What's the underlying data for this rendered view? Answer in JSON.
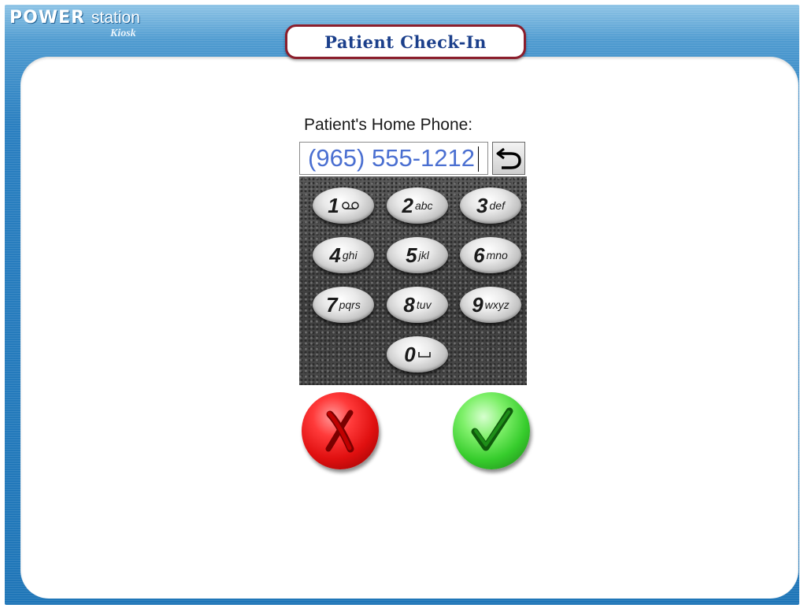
{
  "app": {
    "logo_power": "POWER",
    "logo_station": "station",
    "logo_kiosk": "Kiosk"
  },
  "header": {
    "title": "Patient Check-In"
  },
  "form": {
    "phone_label": "Patient's Home Phone:",
    "phone_value": "(965) 555-1212"
  },
  "keypad": {
    "keys": [
      {
        "digit": "1",
        "letters": "",
        "icon": "voicemail-icon"
      },
      {
        "digit": "2",
        "letters": "abc"
      },
      {
        "digit": "3",
        "letters": "def"
      },
      {
        "digit": "4",
        "letters": "ghi"
      },
      {
        "digit": "5",
        "letters": "jkl"
      },
      {
        "digit": "6",
        "letters": "mno"
      },
      {
        "digit": "7",
        "letters": "pqrs"
      },
      {
        "digit": "8",
        "letters": "tuv"
      },
      {
        "digit": "9",
        "letters": "wxyz"
      },
      {
        "digit": "0",
        "letters": "",
        "icon": "space-icon"
      }
    ]
  },
  "actions": {
    "cancel_icon": "x-icon",
    "confirm_icon": "checkmark-icon",
    "cancel_color": "#e01010",
    "confirm_color": "#36cc2c"
  },
  "colors": {
    "frame_blue": "#1f76b8",
    "title_border": "#8b1e2c",
    "title_text": "#1b3f8b",
    "input_text": "#4a6fd1"
  }
}
